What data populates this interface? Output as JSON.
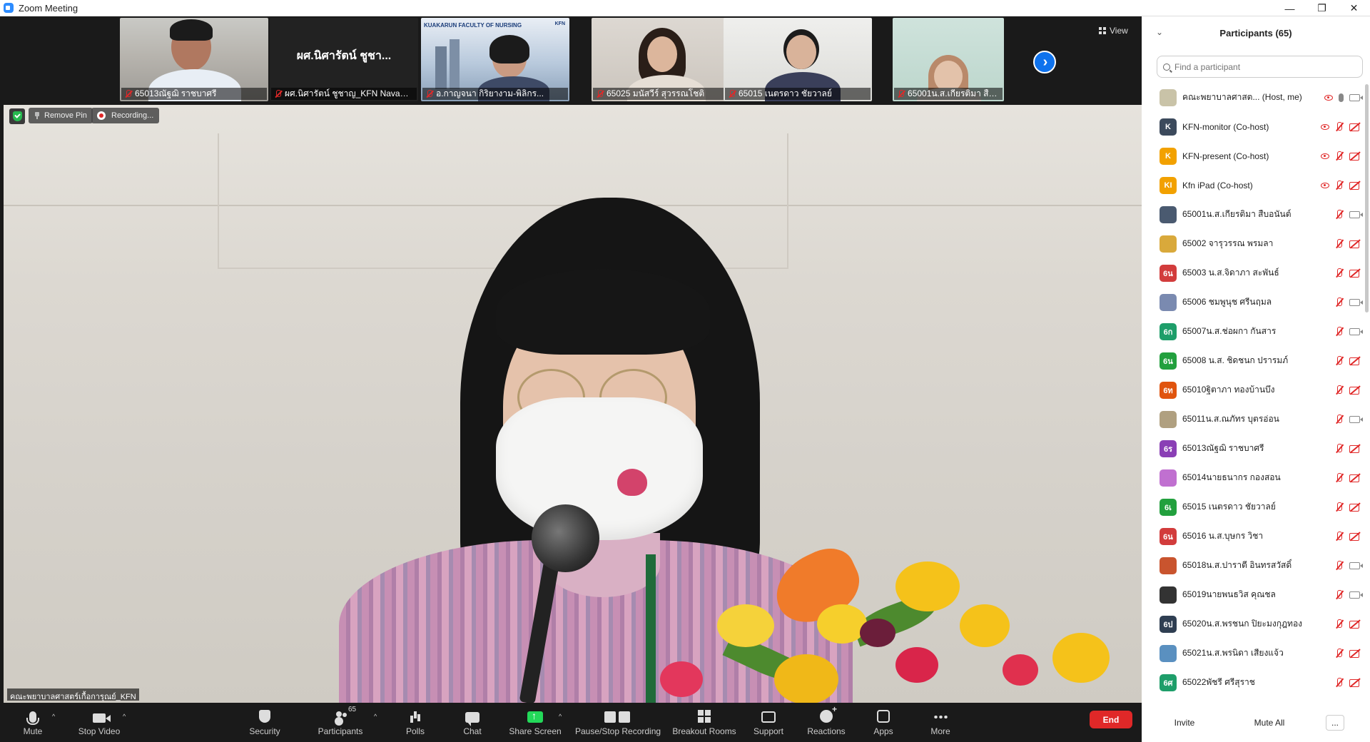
{
  "window": {
    "title": "Zoom Meeting",
    "minimize": "—",
    "restore": "❐",
    "close": "✕"
  },
  "thumbnails": [
    {
      "label": "65013ณัฐฌิ     ราชบาศรี",
      "type": "person"
    },
    {
      "label": "ผศ.นิศารัตน์ ชูชาญ_KFN Navami...",
      "type": "name",
      "big_name": "ผศ.นิศารัตน์ ชูชา..."
    },
    {
      "label": "อ.กาญจนา กิริยางาม-พิลิกร...",
      "type": "slide",
      "slide_title": "KUAKARUN FACULTY OF NURSING",
      "slide_kfn": "KFN"
    },
    {
      "label": "65025 มนัสวีร์ สุวรรณโชติ",
      "type": "person"
    },
    {
      "label": "65015 เนตรดาว ชัยวาลย์",
      "type": "person"
    },
    {
      "label": "65001น.ส.เกียรติมา สืบอนันต์",
      "type": "person"
    }
  ],
  "view_label": "View",
  "overlay": {
    "remove_pin": "Remove Pin",
    "recording": "Recording..."
  },
  "speaker_name": "คณะพยาบาลศาสตร์เกื้อการุณย์_KFN",
  "toolbar": {
    "mute": "Mute",
    "stop_video": "Stop Video",
    "security": "Security",
    "participants": "Participants",
    "participants_count": "65",
    "polls": "Polls",
    "chat": "Chat",
    "share_screen": "Share Screen",
    "pause_recording": "Pause/Stop Recording",
    "breakout_rooms": "Breakout Rooms",
    "support": "Support",
    "reactions": "Reactions",
    "apps": "Apps",
    "more": "More",
    "end": "End",
    "caret": "^"
  },
  "panel": {
    "title": "Participants (65)",
    "collapse": "⌄",
    "search_placeholder": "Find a participant",
    "invite": "Invite",
    "mute_all": "Mute All",
    "more": "..."
  },
  "participants": [
    {
      "name": "คณะพยาบาลศาสต...  (Host, me)",
      "avatar": "",
      "color": "#c9c3a8",
      "rec": true,
      "mic": "on",
      "cam": "on"
    },
    {
      "name": "KFN-monitor (Co-host)",
      "avatar": "K",
      "color": "#3c4a5c",
      "rec": true,
      "mic": "off",
      "cam": "off"
    },
    {
      "name": "KFN-present (Co-host)",
      "avatar": "K",
      "color": "#f2a100",
      "rec": true,
      "mic": "off",
      "cam": "off"
    },
    {
      "name": "Kfn iPad (Co-host)",
      "avatar": "KI",
      "color": "#f2a100",
      "rec": true,
      "mic": "off",
      "cam": "off"
    },
    {
      "name": "65001น.ส.เกียรติมา สืบอนันต์",
      "avatar": "",
      "color": "#4a5a70",
      "rec": false,
      "mic": "off",
      "cam": "on"
    },
    {
      "name": "65002 จารุวรรณ พรมลา",
      "avatar": "",
      "color": "#d9a93b",
      "rec": false,
      "mic": "off",
      "cam": "off"
    },
    {
      "name": "65003 น.ส.จิดาภา สะพันธ์",
      "avatar": "6น",
      "color": "#d23c3c",
      "rec": false,
      "mic": "off",
      "cam": "off"
    },
    {
      "name": "65006 ชมพูนุช ศรีนฤมล",
      "avatar": "",
      "color": "#7a8ab0",
      "rec": false,
      "mic": "off",
      "cam": "on"
    },
    {
      "name": "65007น.ส.ช่อผกา กันสาร",
      "avatar": "6ก",
      "color": "#1e9e6a",
      "rec": false,
      "mic": "off",
      "cam": "on"
    },
    {
      "name": "65008 น.ส. ชิดชนก ปรารมภ์",
      "avatar": "6น",
      "color": "#22a03e",
      "rec": false,
      "mic": "off",
      "cam": "off"
    },
    {
      "name": "65010ฐิตาภา ทองบ้านบึง",
      "avatar": "6ท",
      "color": "#e0540e",
      "rec": false,
      "mic": "off",
      "cam": "off"
    },
    {
      "name": "65011น.ส.ณภัทร บุตรอ่อน",
      "avatar": "",
      "color": "#b0a080",
      "rec": false,
      "mic": "off",
      "cam": "on"
    },
    {
      "name": "65013ณัฐฌิ     ราชบาศรี",
      "avatar": "6ร",
      "color": "#8a3fb5",
      "rec": false,
      "mic": "off",
      "cam": "off"
    },
    {
      "name": "65014นายธนากร กองสอน",
      "avatar": "",
      "color": "#c070d0",
      "rec": false,
      "mic": "off",
      "cam": "off"
    },
    {
      "name": "65015 เนตรดาว ชัยวาลย์",
      "avatar": "6เ",
      "color": "#22a03e",
      "rec": false,
      "mic": "off",
      "cam": "off"
    },
    {
      "name": "65016 น.ส.บุษกร วิชา",
      "avatar": "6น",
      "color": "#d23c3c",
      "rec": false,
      "mic": "off",
      "cam": "off"
    },
    {
      "name": "65018น.ส.ปาราตี อินทรสวัสดิ์",
      "avatar": "",
      "color": "#c9542e",
      "rec": false,
      "mic": "off",
      "cam": "on"
    },
    {
      "name": "65019นายพนธวิส คุณชล",
      "avatar": "",
      "color": "#333333",
      "rec": false,
      "mic": "off",
      "cam": "on"
    },
    {
      "name": "65020น.ส.พรชนก ปิยะมงกุฎทอง",
      "avatar": "6ป",
      "color": "#2f3e52",
      "rec": false,
      "mic": "off",
      "cam": "off"
    },
    {
      "name": "65021น.ส.พรนิดา เสียงแจ้ว",
      "avatar": "",
      "color": "#5a90c0",
      "rec": false,
      "mic": "off",
      "cam": "off"
    },
    {
      "name": "65022พัชรี ศรีสุราช",
      "avatar": "6ศ",
      "color": "#1e9e6a",
      "rec": false,
      "mic": "off",
      "cam": "off"
    }
  ]
}
